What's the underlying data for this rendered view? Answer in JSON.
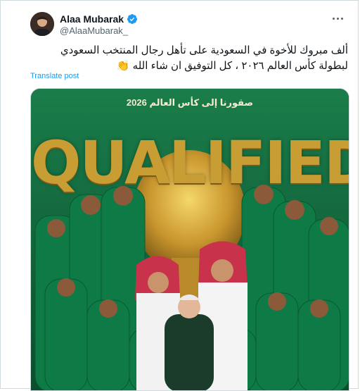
{
  "author": {
    "name": "Alaa Mubarak",
    "handle": "@AlaaMubarak_",
    "verified": true
  },
  "tweet": {
    "text": "ألف مبروك للأخوة في السعودية على تأهل رجال المنتخب السعودي لبطولة كأس العالم ٢٠٢٦ ، كل التوفيق ان شاء الله 👏",
    "translate_label": "Translate post"
  },
  "media": {
    "banner_text": "صقورنا إلى كأس العالم 2026",
    "headline": "QUALIFIED",
    "jersey_color": "#0e7a45",
    "gold_color": "#c89d33"
  },
  "icons": {
    "verified": "verified-badge-icon",
    "more": "more-options-icon"
  }
}
